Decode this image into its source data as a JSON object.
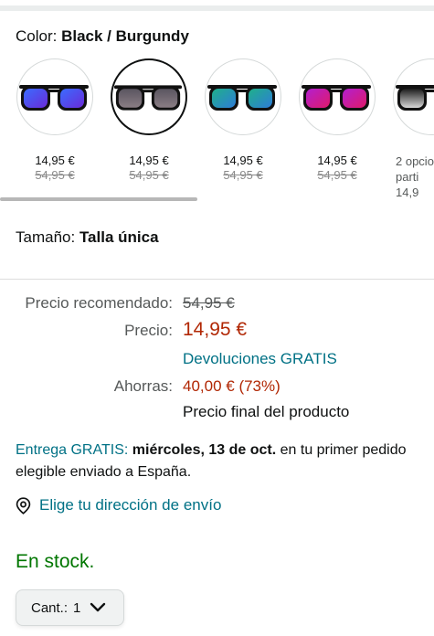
{
  "color": {
    "label": "Color:",
    "value": "Black / Burgundy"
  },
  "swatches": [
    {
      "price": "14,95 €",
      "old_price": "54,95 €",
      "lens": "blue",
      "selected": false
    },
    {
      "price": "14,95 €",
      "old_price": "54,95 €",
      "lens": "grey",
      "selected": true
    },
    {
      "price": "14,95 €",
      "old_price": "54,95 €",
      "lens": "green",
      "selected": false
    },
    {
      "price": "14,95 €",
      "old_price": "54,95 €",
      "lens": "purple",
      "selected": false
    },
    {
      "line1": "2 opcio",
      "line2": "parti",
      "line3": "14,9",
      "lens": "dark-gradient"
    }
  ],
  "size": {
    "label": "Tamaño:",
    "value": "Talla única"
  },
  "pricing": {
    "rec_label": "Precio recomendado:",
    "rec_value": "54,95 €",
    "price_label": "Precio:",
    "price_value": "14,95 €",
    "returns": "Devoluciones GRATIS",
    "save_label": "Ahorras:",
    "save_value": "40,00 € (73%)",
    "final_note": "Precio final del producto"
  },
  "delivery": {
    "prefix": "Entrega GRATIS:",
    "date": "miércoles, 13 de oct.",
    "suffix": "en tu primer pedido elegible enviado a España."
  },
  "address": {
    "label": "Elige tu dirección de envío"
  },
  "stock": {
    "label": "En stock."
  },
  "quantity": {
    "label": "Cant.:",
    "value": "1"
  },
  "colors": {
    "teal": "#007185",
    "red": "#b12704",
    "green": "#007600"
  }
}
